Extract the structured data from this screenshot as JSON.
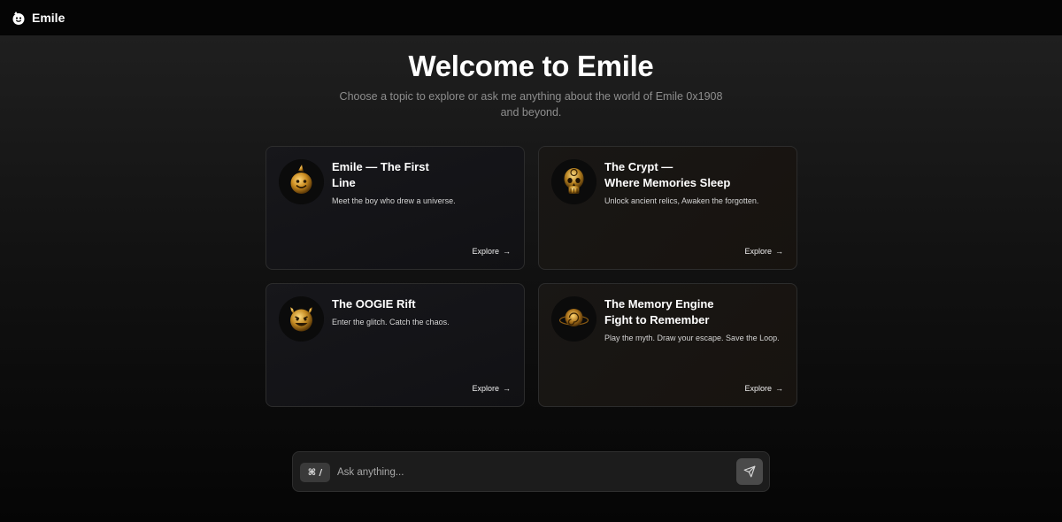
{
  "header": {
    "brand": "Emile",
    "logo_icon": "emile-face-icon"
  },
  "hero": {
    "title": "Welcome to Emile",
    "subtitle": "Choose a topic to explore or ask me anything about the world of Emile 0x1908 and beyond."
  },
  "cards": [
    {
      "title_line1": "Emile — The First",
      "title_line2": "Line",
      "description": "Meet the boy who drew a universe.",
      "cta": "Explore",
      "icon": "golden-smiley-icon"
    },
    {
      "title_line1": "The Crypt —",
      "title_line2": "Where Memories Sleep",
      "description": "Unlock ancient relics, Awaken the forgotten.",
      "cta": "Explore",
      "icon": "golden-skull-icon"
    },
    {
      "title_line1": "The OOGIE Rift",
      "title_line2": "",
      "description": "Enter the glitch. Catch the chaos.",
      "cta": "Explore",
      "icon": "golden-devil-icon"
    },
    {
      "title_line1": "The Memory Engine",
      "title_line2": "Fight to Remember",
      "description": "Play the myth. Draw your escape. Save the Loop.",
      "cta": "Explore",
      "icon": "golden-spiral-orb-icon"
    }
  ],
  "composer": {
    "shortcut": "⌘ /",
    "placeholder": "Ask anything...",
    "send_icon": "send-icon"
  },
  "colors": {
    "background": "#0a0a0a",
    "card_border": "#2c2c2c",
    "gold": "#d9a441"
  }
}
